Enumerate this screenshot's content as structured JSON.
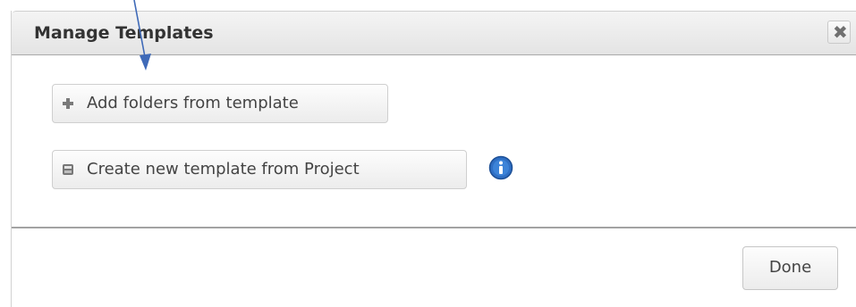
{
  "dialog": {
    "title": "Manage Templates",
    "close_glyph": "✖"
  },
  "actions": {
    "add_folders_label": "Add folders from template",
    "add_folders_icon": "plus-icon",
    "create_template_label": "Create new template from Project",
    "create_template_icon": "save-icon",
    "info_icon": "info-icon"
  },
  "footer": {
    "done_label": "Done"
  },
  "annotation": {
    "arrow_color": "#3f6ab8"
  }
}
